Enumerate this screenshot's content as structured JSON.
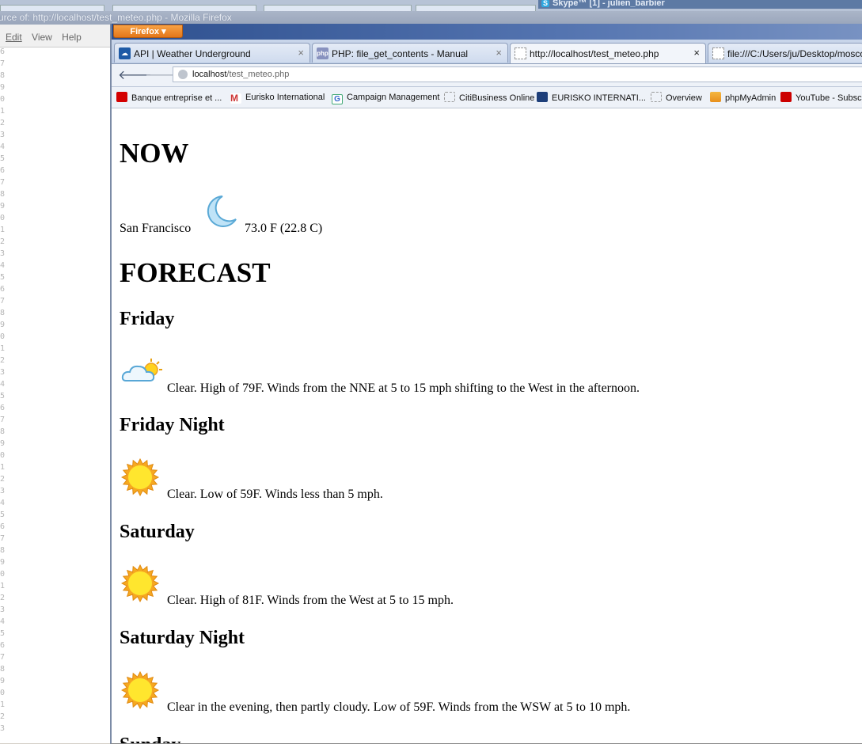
{
  "background_window": {
    "title": "urce of: http://localhost/test_meteo.php - Mozilla Firefox",
    "menu": [
      "Edit",
      "View",
      "Help"
    ],
    "line_numbers": [
      "6",
      "7",
      "8",
      "9",
      "0",
      "1",
      "2",
      "3",
      "4",
      "5",
      "6",
      "7",
      "8",
      "9",
      "0",
      "1",
      "2",
      "3",
      "4",
      "5",
      "6",
      "7",
      "8",
      "9",
      "0",
      "1",
      "2",
      "3",
      "4",
      "5",
      "6",
      "7",
      "8",
      "9",
      "0",
      "1",
      "2",
      "3",
      "4",
      "5",
      "6",
      "7",
      "8",
      "9",
      "0",
      "1",
      "2",
      "3",
      "4",
      "5",
      "6",
      "7",
      "8",
      "9",
      "0",
      "1",
      "2",
      "3"
    ]
  },
  "skype": {
    "label": "Skype™ [1] - julien_barbier"
  },
  "firefox": {
    "menu_button": "Firefox ▾",
    "tabs": [
      {
        "label": "API | Weather Underground",
        "icon": "weather-underground-favicon"
      },
      {
        "label": "PHP: file_get_contents - Manual",
        "icon": "php-favicon"
      },
      {
        "label": "http://localhost/test_meteo.php",
        "icon": "blank-page-favicon",
        "active": true
      },
      {
        "label": "file:///C:/Users/ju/Desktop/moscow.",
        "icon": "blank-page-favicon"
      }
    ],
    "url": {
      "host": "localhost",
      "path": "/test_meteo.php"
    },
    "bookmarks": [
      "Banque entreprise et ...",
      "Eurisko International",
      "Campaign Management",
      "CitiBusiness Online",
      "EURISKO INTERNATI...",
      "Overview",
      "phpMyAdmin",
      "YouTube - Subscr"
    ]
  },
  "page": {
    "now_heading": "NOW",
    "now": {
      "city": "San Francisco",
      "temperature": "73.0 F (22.8 C)",
      "icon": "moon-icon"
    },
    "forecast_heading": "FORECAST",
    "forecast": [
      {
        "day": "Friday",
        "text": "Clear. High of 79F. Winds from the NNE at 5 to 15 mph shifting to the West in the afternoon.",
        "icon": "partly-cloudy-icon"
      },
      {
        "day": "Friday Night",
        "text": "Clear. Low of 59F. Winds less than 5 mph.",
        "icon": "sun-icon"
      },
      {
        "day": "Saturday",
        "text": "Clear. High of 81F. Winds from the West at 5 to 15 mph.",
        "icon": "sun-icon"
      },
      {
        "day": "Saturday Night",
        "text": "Clear in the evening, then partly cloudy. Low of 59F. Winds from the WSW at 5 to 10 mph.",
        "icon": "sun-icon"
      },
      {
        "day": "Sunday"
      }
    ]
  }
}
